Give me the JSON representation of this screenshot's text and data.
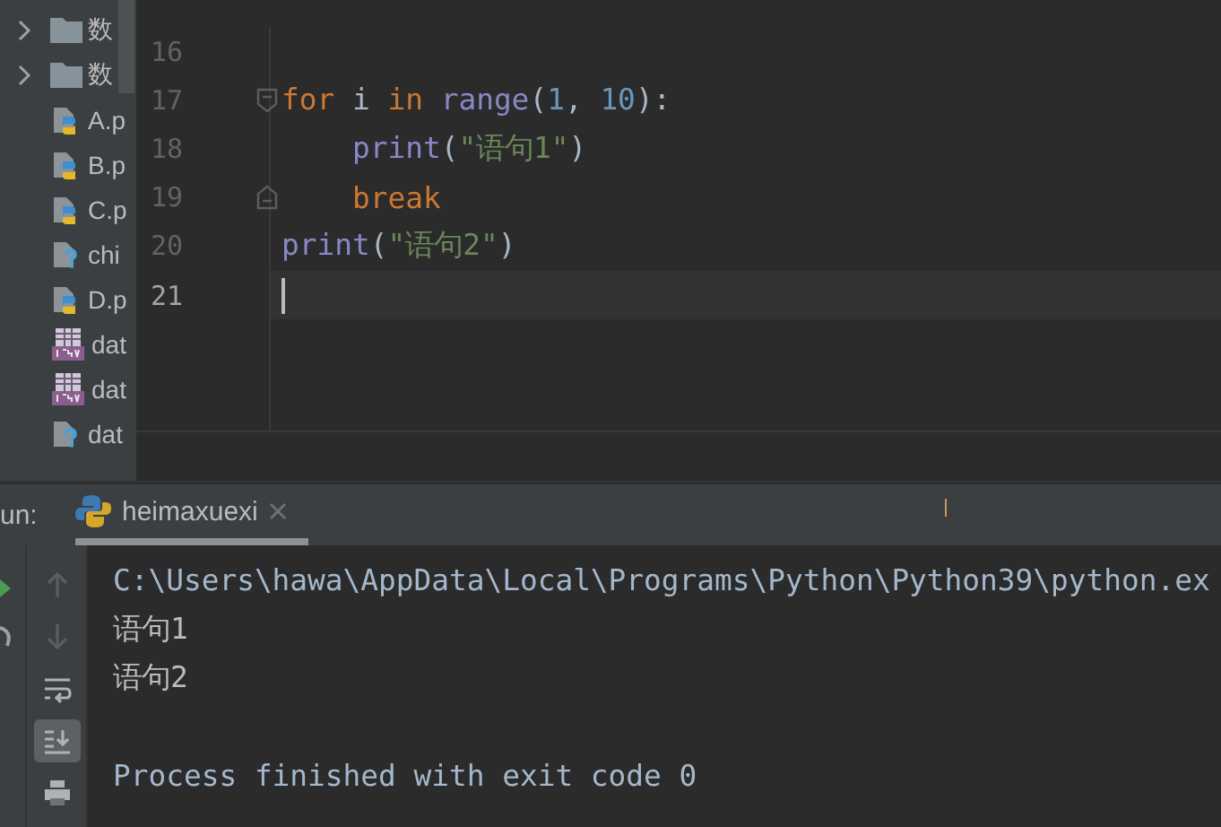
{
  "project_tree": {
    "items": [
      {
        "kind": "folder",
        "label": "数",
        "expanded": false
      },
      {
        "kind": "folder",
        "label": "数",
        "expanded": false
      },
      {
        "kind": "python",
        "label": "A.p"
      },
      {
        "kind": "python",
        "label": "B.p"
      },
      {
        "kind": "python",
        "label": "C.p"
      },
      {
        "kind": "unknown",
        "label": "chi"
      },
      {
        "kind": "python",
        "label": "D.p"
      },
      {
        "kind": "csv",
        "label": "dat"
      },
      {
        "kind": "csv",
        "label": "dat"
      },
      {
        "kind": "unknown",
        "label": "dat"
      }
    ]
  },
  "editor": {
    "lines": [
      {
        "number": "16",
        "kind": "plain"
      },
      {
        "number": "17",
        "kind": "fold-start",
        "tokens": [
          {
            "kind": "keyword",
            "text": "for"
          },
          {
            "kind": "plain",
            "text": " i "
          },
          {
            "kind": "keyword",
            "text": "in"
          },
          {
            "kind": "builtin",
            "text": " range"
          },
          {
            "kind": "plain",
            "text": "("
          },
          {
            "kind": "number",
            "text": "1"
          },
          {
            "kind": "plain",
            "text": ", "
          },
          {
            "kind": "number",
            "text": "10"
          },
          {
            "kind": "plain",
            "text": "):"
          }
        ]
      },
      {
        "number": "18",
        "kind": "plain",
        "tokens": [
          {
            "kind": "builtin",
            "text": "    print"
          },
          {
            "kind": "plain",
            "text": "("
          },
          {
            "kind": "string",
            "text": "\"语句1\""
          },
          {
            "kind": "plain",
            "text": ")"
          }
        ]
      },
      {
        "number": "19",
        "kind": "fold-end",
        "tokens": [
          {
            "kind": "keyword",
            "text": "    break"
          }
        ]
      },
      {
        "number": "20",
        "kind": "plain",
        "tokens": [
          {
            "kind": "builtin",
            "text": "print"
          },
          {
            "kind": "plain",
            "text": "("
          },
          {
            "kind": "string",
            "text": "\"语句2\""
          },
          {
            "kind": "plain",
            "text": ")"
          }
        ]
      },
      {
        "number": "21",
        "kind": "plain",
        "current": true
      }
    ]
  },
  "run_panel": {
    "label": "un:",
    "tabs": [
      {
        "label": "heimaxuexi",
        "selected": true
      }
    ],
    "tools": [
      {
        "kind": "up",
        "on": false
      },
      {
        "kind": "down",
        "on": false
      },
      {
        "kind": "wrap",
        "on": false
      },
      {
        "kind": "scroll-end",
        "on": true
      },
      {
        "kind": "print",
        "on": false
      }
    ],
    "console": [
      {
        "kind": "path",
        "text": "C:\\Users\\hawa\\AppData\\Local\\Programs\\Python\\Python39\\python.ex"
      },
      {
        "kind": "output",
        "text": "语句1"
      },
      {
        "kind": "output",
        "text": "语句2"
      },
      {
        "kind": "blank"
      },
      {
        "kind": "status",
        "text": "Process finished with exit code 0"
      }
    ]
  }
}
